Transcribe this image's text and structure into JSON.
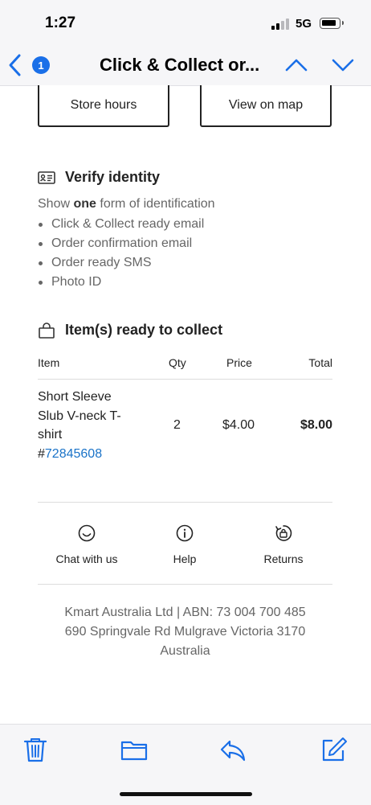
{
  "status_bar": {
    "time": "1:27",
    "network": "5G"
  },
  "nav": {
    "badge_count": "1",
    "title": "Click & Collect or..."
  },
  "store_buttons": {
    "store_hours": "Store hours",
    "view_on_map": "View on map"
  },
  "verify": {
    "title": "Verify identity",
    "intro_prefix": "Show ",
    "intro_emphasis": "one",
    "intro_suffix": " form of identification",
    "forms": [
      "Click & Collect ready email",
      "Order confirmation email",
      "Order ready SMS",
      "Photo ID"
    ]
  },
  "items": {
    "title": "Item(s) ready to collect",
    "headers": {
      "item": "Item",
      "qty": "Qty",
      "price": "Price",
      "total": "Total"
    },
    "rows": [
      {
        "name_line1": "Short Sleeve",
        "name_line2": "Slub V-neck T-",
        "name_line3": "shirt",
        "hash": "#",
        "sku": "72845608",
        "qty": "2",
        "price": "$4.00",
        "total": "$8.00"
      }
    ]
  },
  "footer_links": {
    "chat": "Chat with us",
    "help": "Help",
    "returns": "Returns"
  },
  "company": {
    "line1": "Kmart Australia Ltd | ABN: 73 004 700 485",
    "line2": "690 Springvale Rd Mulgrave Victoria 3170",
    "line3": "Australia"
  },
  "colors": {
    "accent": "#1a6fe8",
    "link": "#1a73c8",
    "text": "#222222",
    "muted": "#666666"
  },
  "icons": [
    "back-chevron-icon",
    "up-chevron-icon",
    "down-chevron-icon",
    "id-card-icon",
    "shopping-bag-icon",
    "smile-icon",
    "info-icon",
    "returns-bag-icon",
    "trash-icon",
    "folder-icon",
    "reply-icon",
    "compose-icon"
  ]
}
